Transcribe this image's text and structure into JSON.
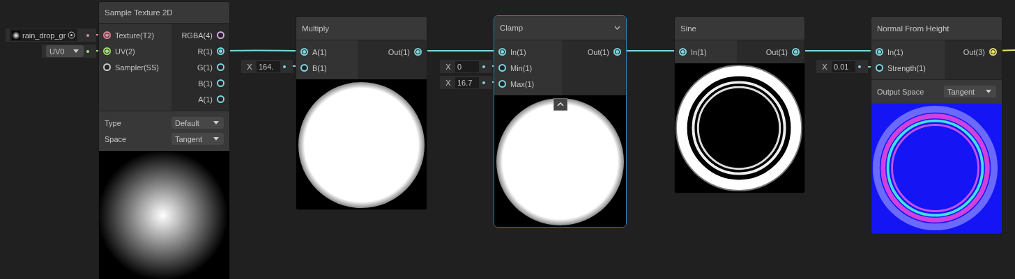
{
  "nodes": [
    {
      "title": "Sample Texture 2D",
      "selected": false,
      "inputs": [
        {
          "label": "Texture(T2)",
          "color": "#e08a9c",
          "connected": true
        },
        {
          "label": "UV(2)",
          "color": "#a8e07a",
          "connected": true
        },
        {
          "label": "Sampler(SS)",
          "color": "#cfcfcf",
          "connected": false
        }
      ],
      "outputs": [
        {
          "label": "RGBA(4)",
          "color": "#d8a8e8",
          "connected": false
        },
        {
          "label": "R(1)",
          "color": "#7fd6e0",
          "connected": true
        },
        {
          "label": "G(1)",
          "color": "#7fd6e0",
          "connected": false
        },
        {
          "label": "B(1)",
          "color": "#7fd6e0",
          "connected": false
        },
        {
          "label": "A(1)",
          "color": "#7fd6e0",
          "connected": false
        }
      ],
      "settings": [
        {
          "label": "Type",
          "value": "Default"
        },
        {
          "label": "Space",
          "value": "Tangent"
        }
      ],
      "preview": {
        "kind": "picture"
      }
    },
    {
      "title": "Multiply",
      "selected": false,
      "inputs": [
        {
          "label": "A(1)",
          "color": "#7fd6e0",
          "connected": true
        },
        {
          "label": "B(1)",
          "color": "#7fd6e0",
          "connected": false
        }
      ],
      "outputs": [
        {
          "label": "Out(1)",
          "color": "#7fd6e0",
          "connected": true
        }
      ],
      "preview": {
        "kind": "picture"
      }
    },
    {
      "title": "Clamp",
      "selected": true,
      "inputs": [
        {
          "label": "In(1)",
          "color": "#7fd6e0",
          "connected": true
        },
        {
          "label": "Min(1)",
          "color": "#7fd6e0",
          "connected": false
        },
        {
          "label": "Max(1)",
          "color": "#7fd6e0",
          "connected": false
        }
      ],
      "outputs": [
        {
          "label": "Out(1)",
          "color": "#7fd6e0",
          "connected": true
        }
      ],
      "preview": {
        "kind": "picture"
      }
    },
    {
      "title": "Sine",
      "selected": false,
      "inputs": [
        {
          "label": "In(1)",
          "color": "#7fd6e0",
          "connected": true
        }
      ],
      "outputs": [
        {
          "label": "Out(1)",
          "color": "#7fd6e0",
          "connected": true
        }
      ],
      "preview": {
        "kind": "picture"
      }
    },
    {
      "title": "Normal From Height",
      "selected": false,
      "inputs": [
        {
          "label": "In(1)",
          "color": "#7fd6e0",
          "connected": true
        },
        {
          "label": "Strength(1)",
          "color": "#7fd6e0",
          "connected": false
        }
      ],
      "outputs": [
        {
          "label": "Out(3)",
          "color": "#e8e070",
          "connected": true
        }
      ],
      "settings": [
        {
          "label": "Output Space",
          "value": "Tangent"
        }
      ],
      "preview": {
        "kind": "picture"
      }
    }
  ],
  "inline_inputs": [
    {
      "kind": "texture",
      "value": "rain_drop_gr"
    },
    {
      "kind": "dropdown",
      "value": "UV0"
    },
    {
      "kind": "vector",
      "axis": "X",
      "value": "164."
    },
    {
      "kind": "vector",
      "axis": "X",
      "value": "0"
    },
    {
      "kind": "vector",
      "axis": "X",
      "value": "16.7"
    },
    {
      "kind": "vector",
      "axis": "X",
      "value": "0.01"
    }
  ]
}
